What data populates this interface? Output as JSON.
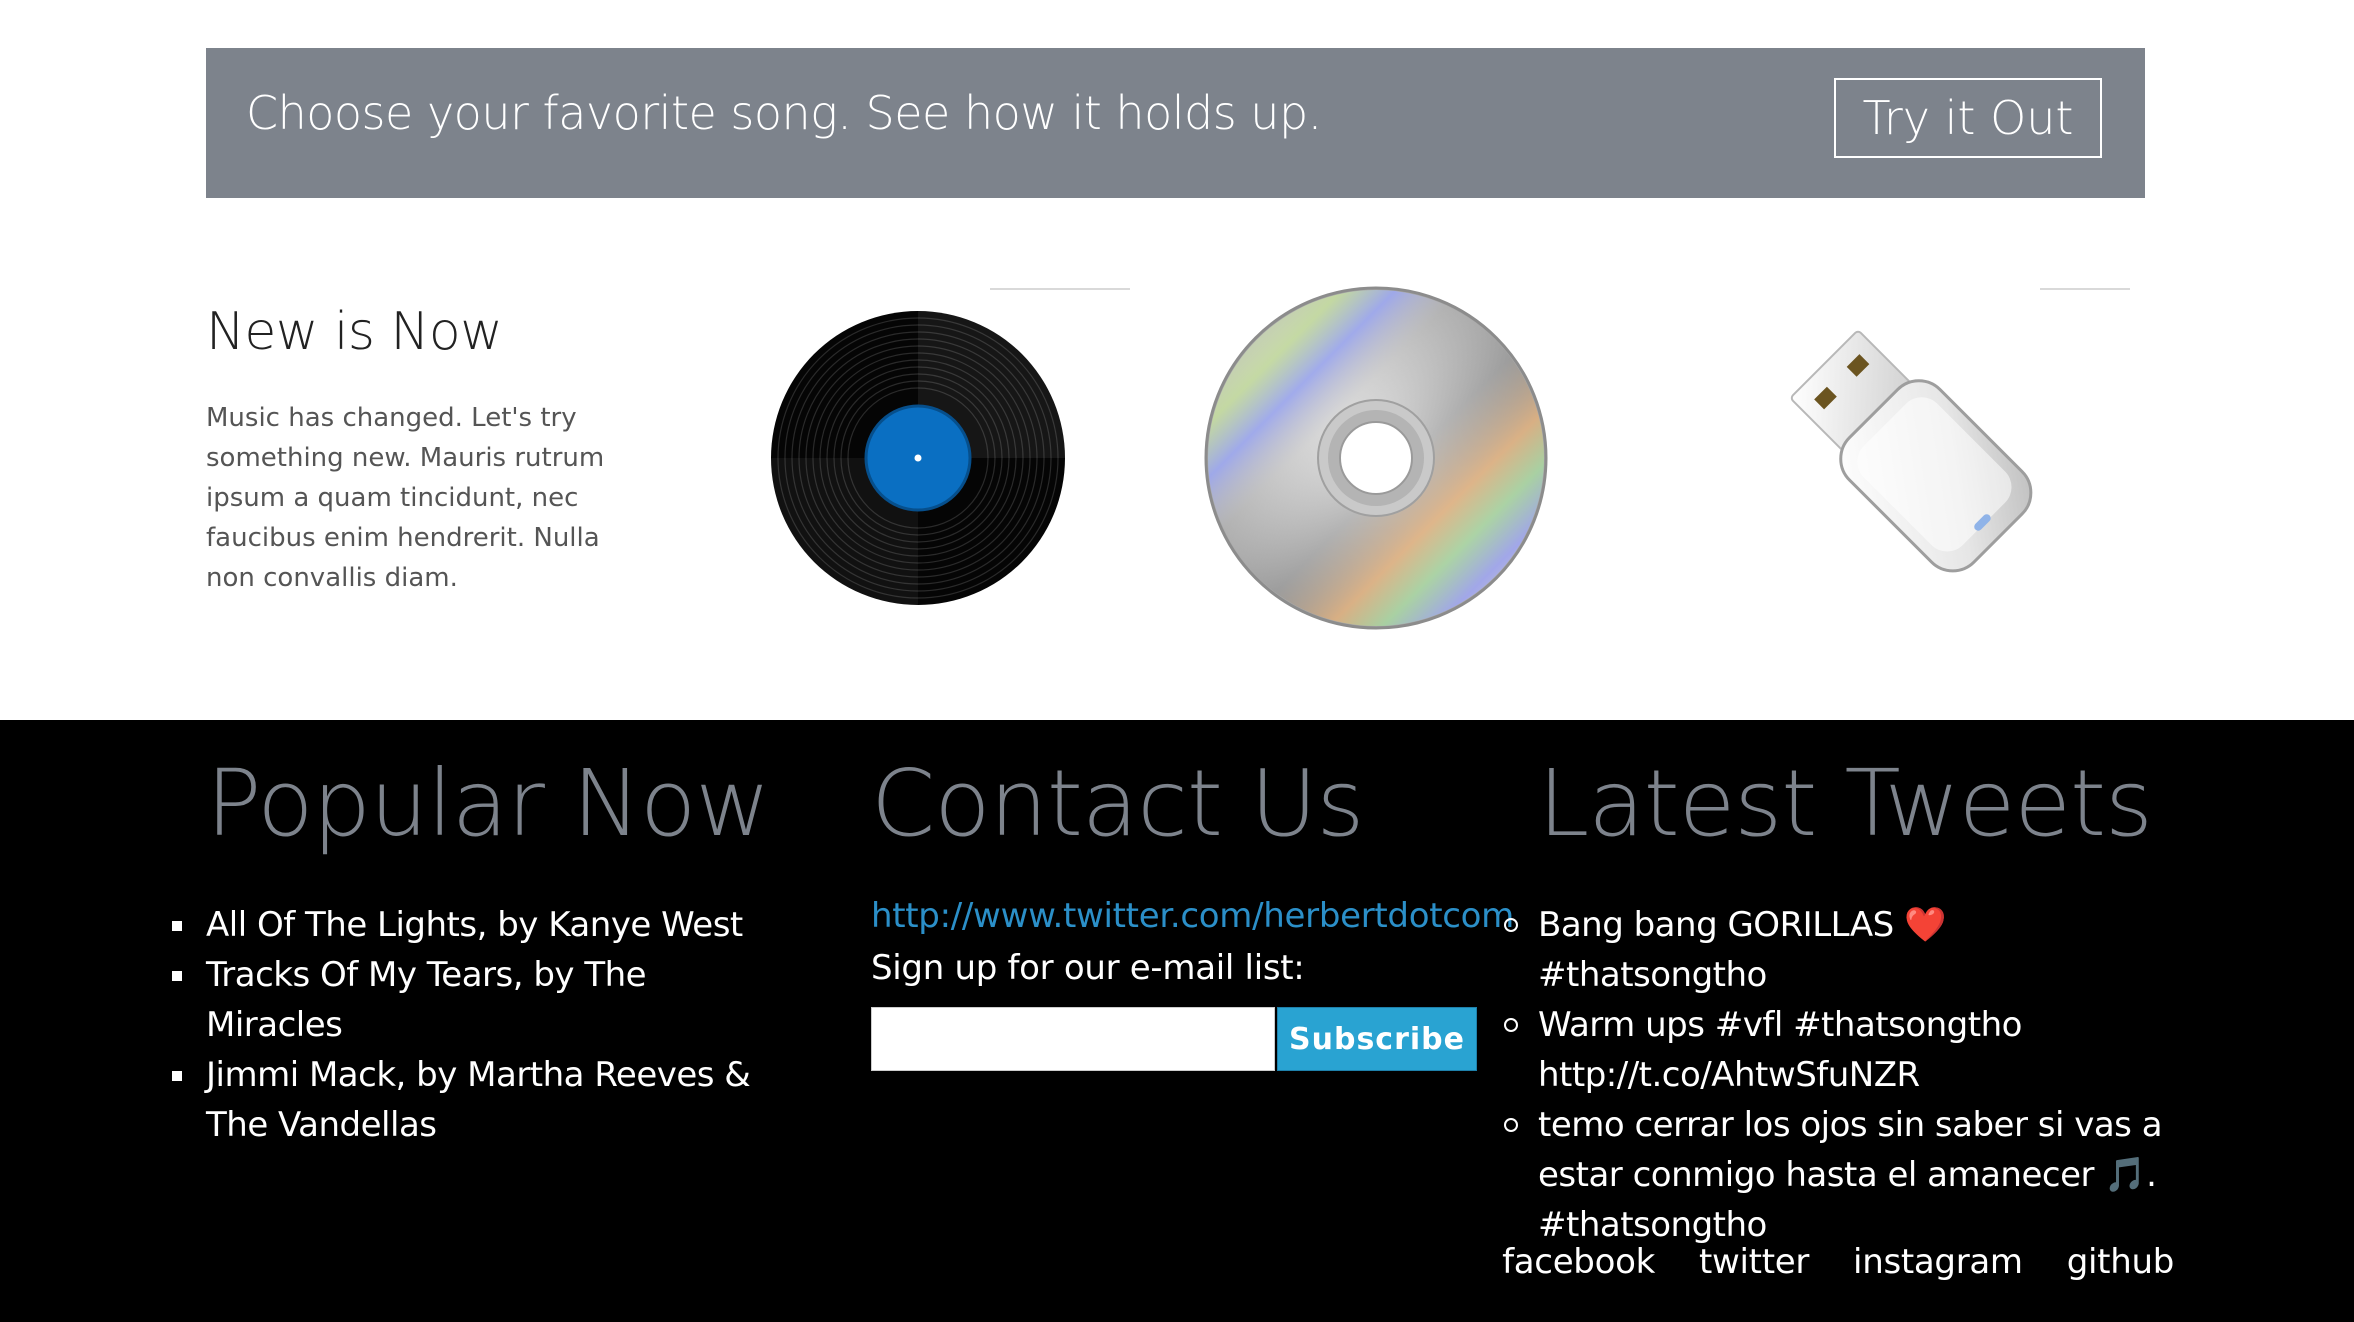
{
  "banner": {
    "text": "Choose your favorite song. See how it holds up.",
    "button_label": "Try it Out"
  },
  "intro": {
    "title": "New is Now",
    "text": "Music has changed. Let's try something new. Mauris rutrum ipsum a quam tincidunt, nec faucibus enim hendrerit. Nulla non convallis diam."
  },
  "images": [
    "vinyl-record",
    "compact-disc",
    "usb-flash-drive"
  ],
  "footer": {
    "popular": {
      "title": "Popular Now",
      "items": [
        "All Of The Lights, by Kanye West",
        "Tracks Of My Tears, by The Miracles",
        "Jimmi Mack, by Martha Reeves & The Vandellas"
      ]
    },
    "contact": {
      "title": "Contact Us",
      "link": "http://www.twitter.com/herbertdotcom",
      "signup_label": "Sign up for our e-mail list:",
      "email_value": "",
      "subscribe_label": "Subscribe"
    },
    "tweets": {
      "title": "Latest Tweets",
      "items": [
        {
          "before": "Bang bang GORILLAS ",
          "emoji": "❤️",
          "after": " #thatsongtho"
        },
        {
          "before": "Warm ups #vfl #thatsongtho http://t.co/AhtwSfuNZR",
          "emoji": "",
          "after": ""
        },
        {
          "before": "temo cerrar los ojos sin saber si vas a estar conmigo hasta el amanecer ",
          "emoji": "🎵",
          "after": ". #thatsongtho"
        }
      ]
    },
    "social": [
      "facebook",
      "twitter",
      "instagram",
      "github"
    ]
  },
  "colors": {
    "banner_bg": "#7d838c",
    "footer_bg": "#000000",
    "heading_gray": "#7d838c",
    "link_blue": "#2b8fc8",
    "button_blue": "#29a3d2",
    "vinyl_label": "#0a6fc2"
  }
}
